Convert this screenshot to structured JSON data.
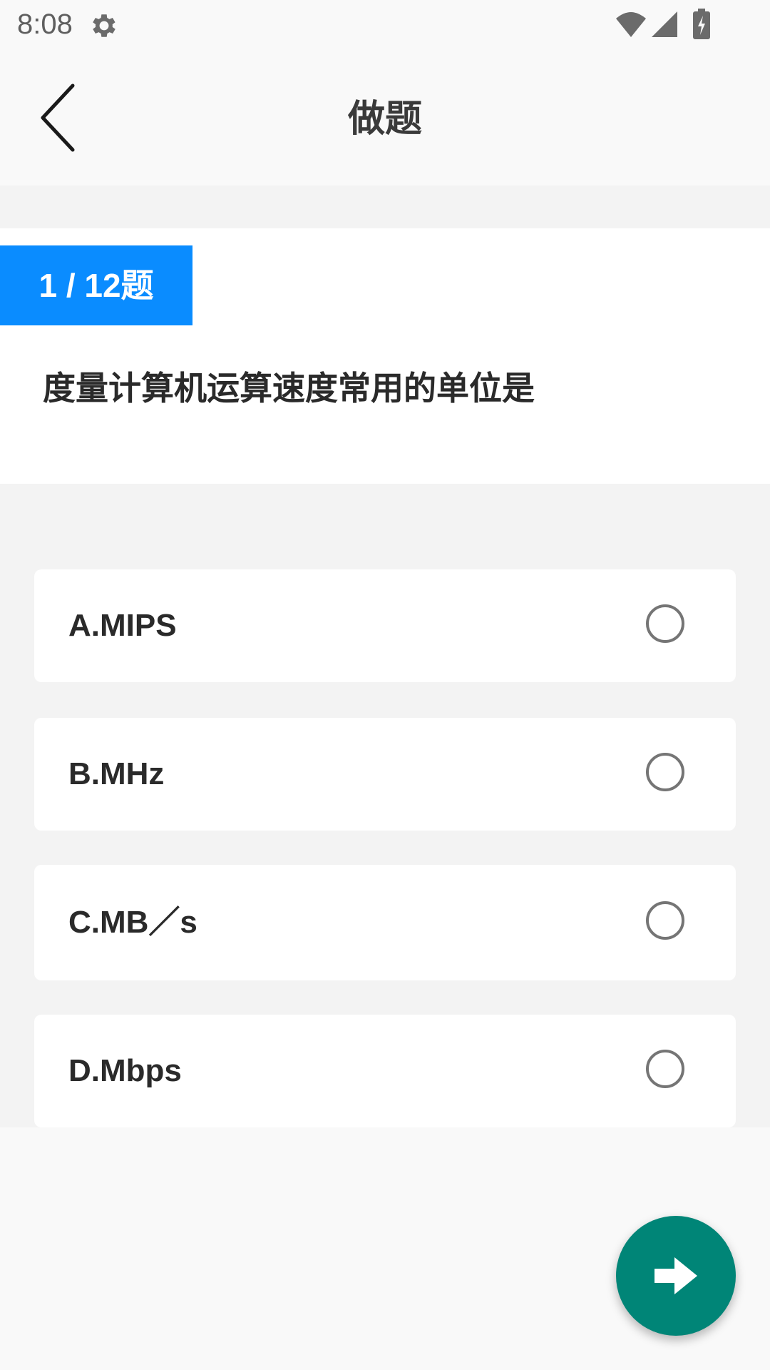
{
  "status_bar": {
    "time": "8:08",
    "icons": [
      "gear-icon",
      "wifi-icon",
      "signal-icon",
      "battery-charging-icon"
    ]
  },
  "header": {
    "title": "做题",
    "back_icon": "chevron-left-icon"
  },
  "question": {
    "progress": "1 / 12题",
    "current": 1,
    "total": 12,
    "text": "度量计算机运算速度常用的单位是"
  },
  "options": [
    {
      "label": "A.MIPS",
      "selected": false
    },
    {
      "label": "B.MHz",
      "selected": false
    },
    {
      "label": "C.MB／s",
      "selected": false
    },
    {
      "label": "D.Mbps",
      "selected": false
    }
  ],
  "fab": {
    "icon": "arrow-right-icon",
    "color": "#008577"
  },
  "colors": {
    "accent": "#0a8cff",
    "fab": "#008577"
  }
}
